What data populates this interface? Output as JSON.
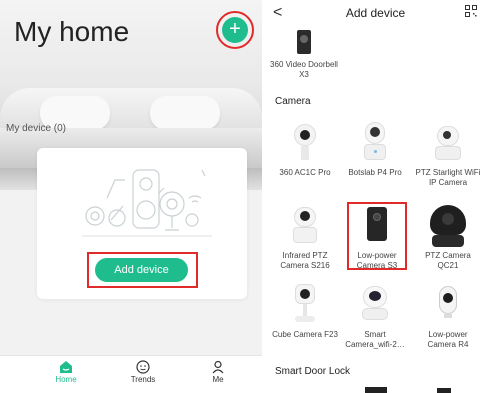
{
  "left": {
    "title": "My home",
    "add_icon": "plus-icon",
    "my_device_label": "My device (0)",
    "add_device_button": "Add device",
    "tabs": [
      {
        "label": "Home",
        "icon": "home-icon"
      },
      {
        "label": "Trends",
        "icon": "smiley-icon"
      },
      {
        "label": "Me",
        "icon": "person-icon"
      }
    ],
    "accent_color": "#1fbd8e",
    "highlight_color": "#e12b2b"
  },
  "right": {
    "back_symbol": "<",
    "title": "Add device",
    "top_device": {
      "label": "360 Video Doorbell X3"
    },
    "sections": [
      "Camera",
      "Smart Door Lock"
    ],
    "cameras": [
      {
        "label": "360 AC1C Pro"
      },
      {
        "label": "Botslab P4 Pro"
      },
      {
        "label": "PTZ Starlight WiFi IP Camera"
      },
      {
        "label": "Infrared PTZ Camera S216"
      },
      {
        "label": "Low-power Camera S3"
      },
      {
        "label": "PTZ Camera QC21"
      },
      {
        "label": "Cube Camera F23"
      },
      {
        "label": "Smart Camera_wifi-2…"
      },
      {
        "label": "Low-power Camera R4"
      }
    ]
  }
}
